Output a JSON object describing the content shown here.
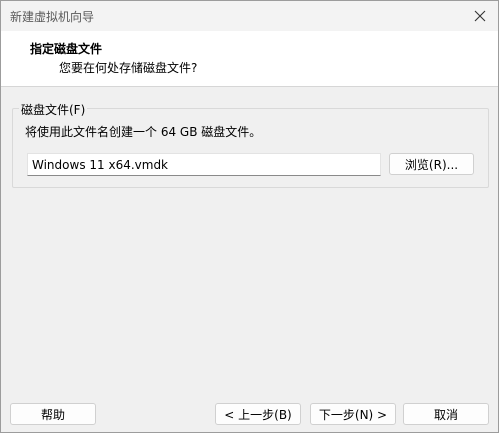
{
  "window": {
    "title": "新建虚拟机向导"
  },
  "header": {
    "title": "指定磁盘文件",
    "subtitle": "您要在何处存储磁盘文件?"
  },
  "disk_group": {
    "legend": "磁盘文件(F)",
    "description": "将使用此文件名创建一个 64 GB 磁盘文件。",
    "file_value": "Windows 11 x64.vmdk",
    "browse_label": "浏览(R)..."
  },
  "footer": {
    "help_label": "帮助",
    "back_label": "< 上一步(B)",
    "next_label": "下一步(N) >",
    "cancel_label": "取消"
  },
  "icons": {
    "close": "close-icon"
  }
}
